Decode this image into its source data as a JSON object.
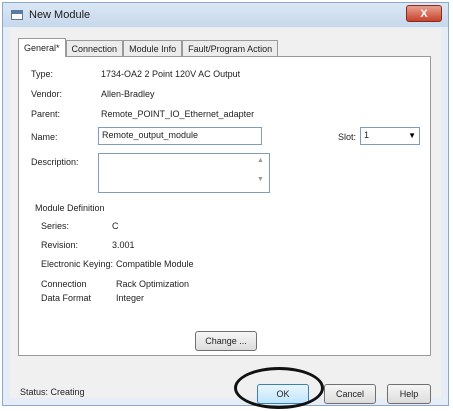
{
  "window": {
    "title": "New Module",
    "close_label": "X"
  },
  "tabs": [
    "General*",
    "Connection",
    "Module Info",
    "Fault/Program Action"
  ],
  "general": {
    "type_label": "Type:",
    "type_value": "1734-OA2 2 Point 120V AC Output",
    "vendor_label": "Vendor:",
    "vendor_value": "Allen-Bradley",
    "parent_label": "Parent:",
    "parent_value": "Remote_POINT_IO_Ethernet_adapter",
    "name_label": "Name:",
    "name_value": "Remote_output_module",
    "slot_label": "Slot:",
    "slot_value": "1",
    "description_label": "Description:",
    "description_value": ""
  },
  "definition": {
    "heading": "Module Definition",
    "series_label": "Series:",
    "series_value": "C",
    "revision_label": "Revision:",
    "revision_value": "3.001",
    "keying_label": "Electronic Keying:",
    "keying_value": "Compatible Module",
    "connection_label": "Connection",
    "connection_value": "Rack Optimization",
    "data_format_label": "Data Format",
    "data_format_value": "Integer",
    "change_button": "Change ..."
  },
  "footer": {
    "status": "Status: Creating",
    "ok": "OK",
    "cancel": "Cancel",
    "help": "Help"
  }
}
